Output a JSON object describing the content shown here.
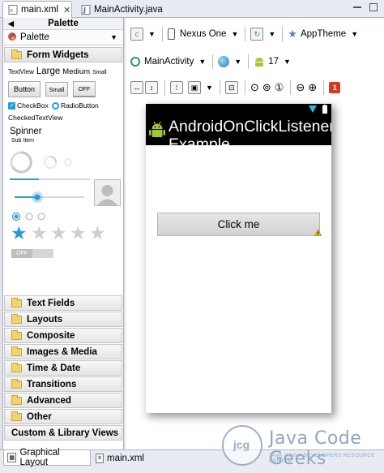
{
  "tabs": {
    "main_xml": "main.xml",
    "main_activity": "MainActivity.java"
  },
  "palette": {
    "title": "Palette",
    "selector": "Palette",
    "open_category": "Form Widgets",
    "widgets": {
      "textview": "TextView",
      "large": "Large",
      "medium": "Medium",
      "small": "Small",
      "button": "Button",
      "small_button": "Small",
      "toggle_off": "OFF",
      "checkbox": "CheckBox",
      "radiobutton": "RadioButton",
      "checked_textview": "CheckedTextView",
      "spinner": "Spinner",
      "sub_item": "Sub Item",
      "switch_off": "OFF"
    },
    "categories": [
      "Text Fields",
      "Layouts",
      "Composite",
      "Images & Media",
      "Time & Date",
      "Transitions",
      "Advanced",
      "Other",
      "Custom & Library Views"
    ]
  },
  "toolbar": {
    "device": "Nexus One",
    "theme": "AppTheme",
    "activity": "MainActivity",
    "api_level": "17",
    "warning_count": "1"
  },
  "device": {
    "app_title": "AndroidOnClickListenerExample",
    "button_label": "Click me"
  },
  "bottom_tabs": {
    "graphical_layout": "Graphical Layout",
    "main_xml": "main.xml"
  },
  "watermark": {
    "logo": "jcg",
    "brand": "Java Code Geeks",
    "tagline": "JAVA 2 JAVA DEVELOPERS RESOURCE CENTER"
  },
  "colors": {
    "accent_blue": "#2a9bd6",
    "android_green": "#a4c639",
    "warning_red": "#d43b26"
  }
}
